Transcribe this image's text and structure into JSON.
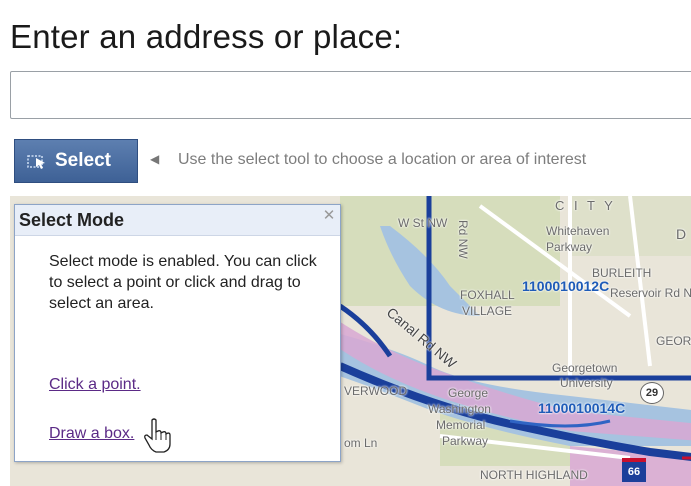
{
  "page_title": "Enter an address or place:",
  "address_input": {
    "value": "",
    "placeholder": ""
  },
  "toolbar": {
    "select_label": "Select",
    "select_icon": "select-tool-icon",
    "collapse_icon": "triangle-left-icon",
    "hint": "Use the select tool to choose a location or area of interest"
  },
  "popup": {
    "title": "Select Mode",
    "close_icon": "close-icon",
    "body": "Select mode is enabled. You can click to select a point or click and drag to select an area.",
    "link_point": "Click a point.",
    "link_box": "Draw a box."
  },
  "map": {
    "labels": {
      "w_st": "W St NW",
      "rd_nw": "Rd NW",
      "city": "C I T Y",
      "whitehaven": "Whitehaven",
      "parkway": "Parkway",
      "burleith": "BURLEITH",
      "reservoir": "Reservoir Rd NW",
      "foxhall": "FOXHALL",
      "village": "VILLAGE",
      "canal": "Canal Rd NW",
      "georgetown": "Georgetown",
      "university": "University",
      "georg": "GEORG",
      "verwood": "VERWOOD",
      "george": "George",
      "washington": "Washington",
      "memorial": "Memorial",
      "parkway2": "Parkway",
      "om_ln": "om Ln",
      "north_highland": "NORTH HIGHLAND",
      "d": "D"
    },
    "parcels": {
      "p1": "1100010012C",
      "p2": "1100010014C"
    },
    "shields": {
      "route": "29",
      "interstate": "66"
    },
    "colors": {
      "highlight_line": "#1a3f9b",
      "river": "#a6c3e0",
      "land": "#e9e5d9"
    }
  },
  "cursor_icon": "hand-pointer-icon"
}
